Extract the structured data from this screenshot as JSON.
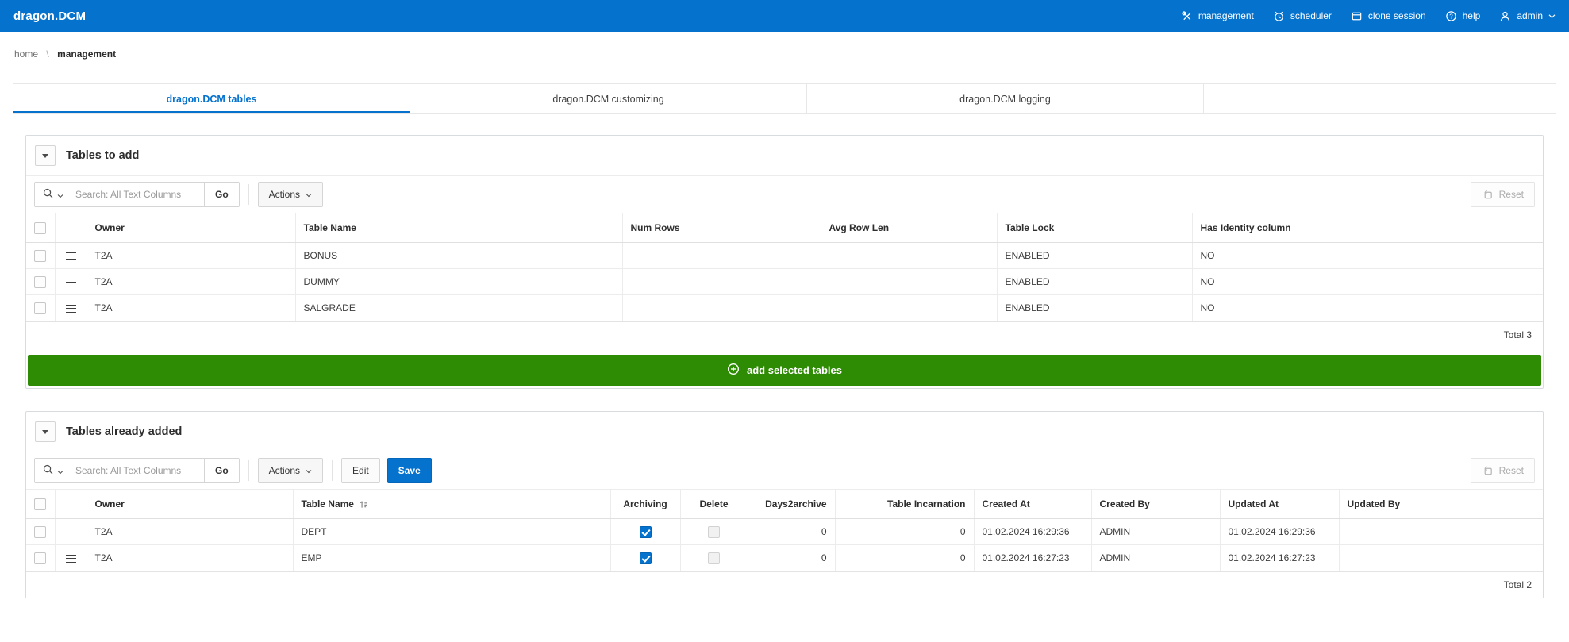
{
  "app": {
    "title": "dragon.DCM"
  },
  "header": {
    "nav": [
      {
        "icon": "tools-icon",
        "label": "management"
      },
      {
        "icon": "alarm-clock-icon",
        "label": "scheduler"
      },
      {
        "icon": "window-icon",
        "label": "clone session"
      },
      {
        "icon": "help-circle-icon",
        "label": "help"
      },
      {
        "icon": "user-icon",
        "label": "admin"
      }
    ]
  },
  "breadcrumb": {
    "home": "home",
    "separator": "\\",
    "current": "management"
  },
  "tabs": [
    {
      "label": "dragon.DCM tables",
      "active": true
    },
    {
      "label": "dragon.DCM customizing",
      "active": false
    },
    {
      "label": "dragon.DCM logging",
      "active": false
    }
  ],
  "region1": {
    "title": "Tables to add",
    "toolbar": {
      "search_placeholder": "Search: All Text Columns",
      "go": "Go",
      "actions": "Actions",
      "reset": "Reset"
    },
    "columns": [
      "Owner",
      "Table Name",
      "Num Rows",
      "Avg Row Len",
      "Table Lock",
      "Has Identity column"
    ],
    "rows": [
      {
        "owner": "T2A",
        "table_name": "BONUS",
        "num_rows": "",
        "avg_row_len": "",
        "table_lock": "ENABLED",
        "has_identity": "NO"
      },
      {
        "owner": "T2A",
        "table_name": "DUMMY",
        "num_rows": "",
        "avg_row_len": "",
        "table_lock": "ENABLED",
        "has_identity": "NO"
      },
      {
        "owner": "T2A",
        "table_name": "SALGRADE",
        "num_rows": "",
        "avg_row_len": "",
        "table_lock": "ENABLED",
        "has_identity": "NO"
      }
    ],
    "total": "Total 3",
    "add_button": "add selected tables"
  },
  "region2": {
    "title": "Tables already added",
    "toolbar": {
      "search_placeholder": "Search: All Text Columns",
      "go": "Go",
      "actions": "Actions",
      "edit": "Edit",
      "save": "Save",
      "reset": "Reset"
    },
    "columns": [
      "Owner",
      "Table Name",
      "Archiving",
      "Delete",
      "Days2archive",
      "Table Incarnation",
      "Created At",
      "Created By",
      "Updated At",
      "Updated By"
    ],
    "rows": [
      {
        "owner": "T2A",
        "table_name": "DEPT",
        "archiving": true,
        "delete": false,
        "days2archive": "0",
        "table_incarnation": "0",
        "created_at": "01.02.2024 16:29:36",
        "created_by": "ADMIN",
        "updated_at": "01.02.2024 16:29:36",
        "updated_by": ""
      },
      {
        "owner": "T2A",
        "table_name": "EMP",
        "archiving": true,
        "delete": false,
        "days2archive": "0",
        "table_incarnation": "0",
        "created_at": "01.02.2024 16:27:23",
        "created_by": "ADMIN",
        "updated_at": "01.02.2024 16:27:23",
        "updated_by": ""
      }
    ],
    "total": "Total 2"
  },
  "colors": {
    "header_blue": "#0572ce",
    "accent_blue": "#0572ce",
    "button_green": "#2e8b04",
    "checkbox_checked": "#0572ce"
  }
}
